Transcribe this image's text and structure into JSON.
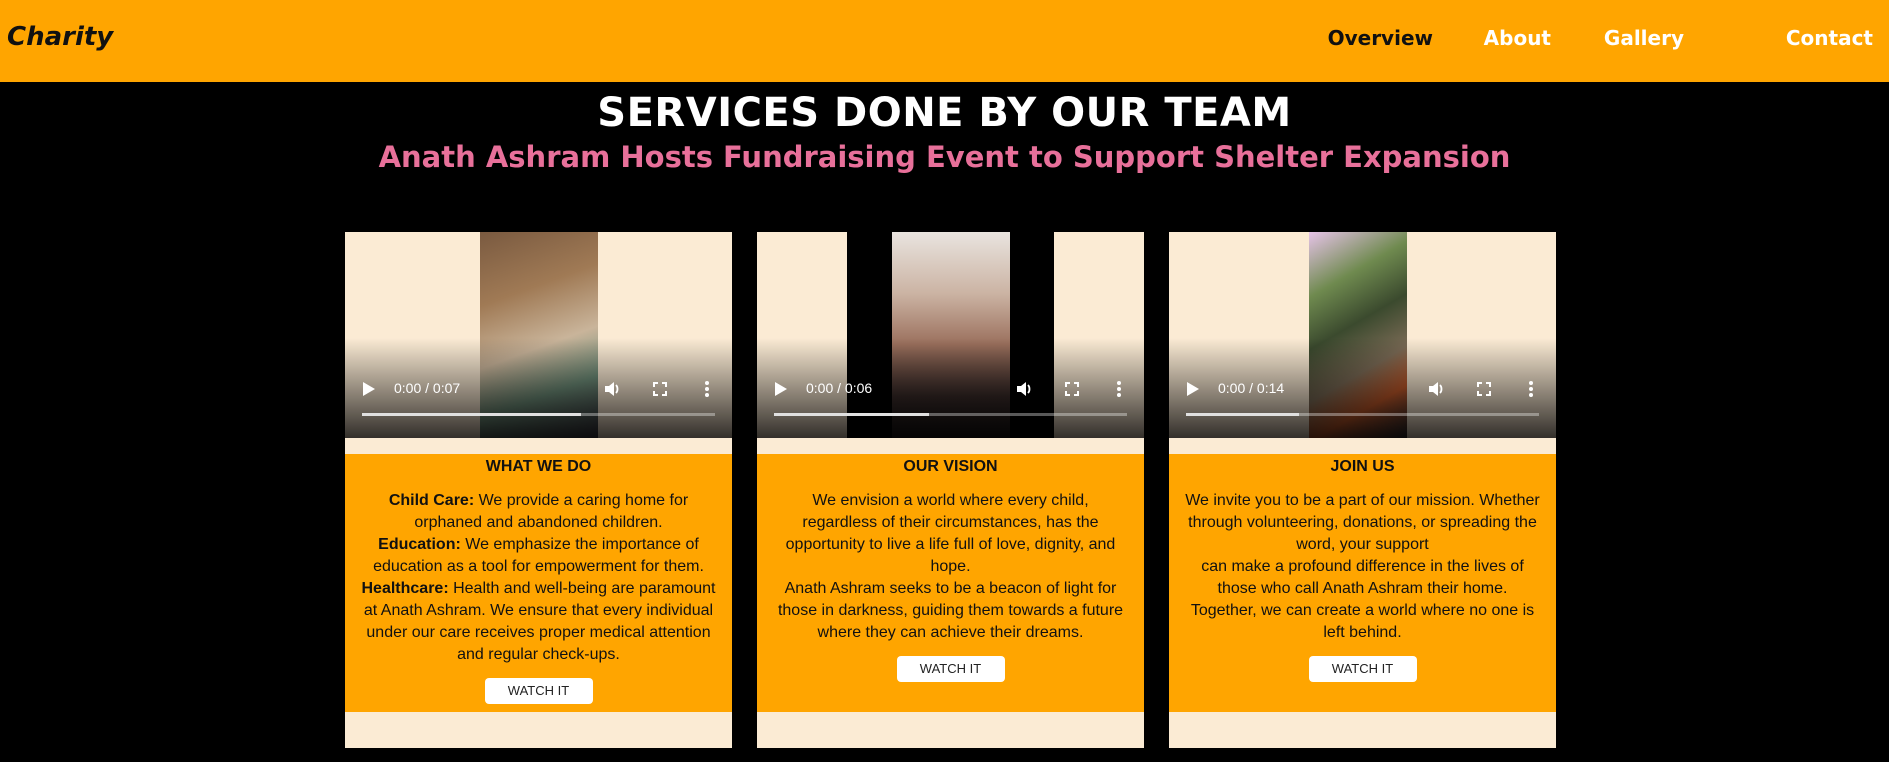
{
  "navbar": {
    "brand": "Charity",
    "links": [
      "Overview",
      "About",
      "Gallery",
      "Contact"
    ]
  },
  "section": {
    "title": "SERVICES DONE BY OUR TEAM",
    "subtitle": "Anath Ashram Hosts Fundraising Event to Support Shelter Expansion"
  },
  "cards": [
    {
      "video_time": "0:00 / 0:07",
      "video_progress": 0.62,
      "title": "WHAT WE DO",
      "items": [
        {
          "label": "Child Care:",
          "text": " We provide a caring home for orphaned and abandoned children."
        },
        {
          "label": "Education:",
          "text": " We emphasize the importance of education as a tool for empowerment for them."
        },
        {
          "label": "Healthcare:",
          "text": " Health and well-being are paramount at Anath Ashram. We ensure that every individual under our care receives proper medical attention and regular check-ups."
        }
      ],
      "button": "WATCH IT"
    },
    {
      "video_time": "0:00 / 0:06",
      "video_progress": 0.44,
      "title": "OUR VISION",
      "text1": "We envision a world where every child, regardless of their circumstances, has the opportunity to live a life full of love, dignity, and hope.",
      "text2": "Anath Ashram seeks to be a beacon of light for those in darkness, guiding them towards a future where they can achieve their dreams.",
      "button": "WATCH IT"
    },
    {
      "video_time": "0:00 / 0:14",
      "video_progress": 0.32,
      "title": "JOIN US",
      "text1": "We invite you to be a part of our mission. Whether through volunteering, donations, or spreading the word, your support",
      "text2": "can make a profound difference in the lives of those who call Anath Ashram their home. Together, we can create a world where no one is left behind.",
      "button": "WATCH IT"
    }
  ],
  "colors": {
    "nav_bg": "#ffa500",
    "accent_pink": "#e8709a",
    "card_bg": "#fbebd4",
    "page_bg": "#000000"
  }
}
